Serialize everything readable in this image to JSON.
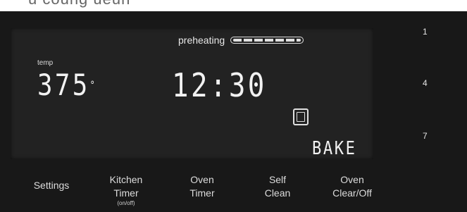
{
  "header": {
    "cropped_title": "u coung ueun"
  },
  "display": {
    "preheating_label": "preheating",
    "preheat_progress": 1.0,
    "temp_label": "temp",
    "temperature": "375",
    "degree_symbol": "°",
    "clock": "12:30",
    "mode": "BAKE"
  },
  "keypad": {
    "digits": [
      "1",
      "4",
      "7"
    ]
  },
  "buttons": [
    {
      "line1": "Settings",
      "line2": "",
      "sub": ""
    },
    {
      "line1": "Kitchen",
      "line2": "Timer",
      "sub": "(on/off)"
    },
    {
      "line1": "Oven",
      "line2": "Timer",
      "sub": ""
    },
    {
      "line1": "Self",
      "line2": "Clean",
      "sub": ""
    },
    {
      "line1": "Oven",
      "line2": "Clear/Off",
      "sub": ""
    }
  ]
}
